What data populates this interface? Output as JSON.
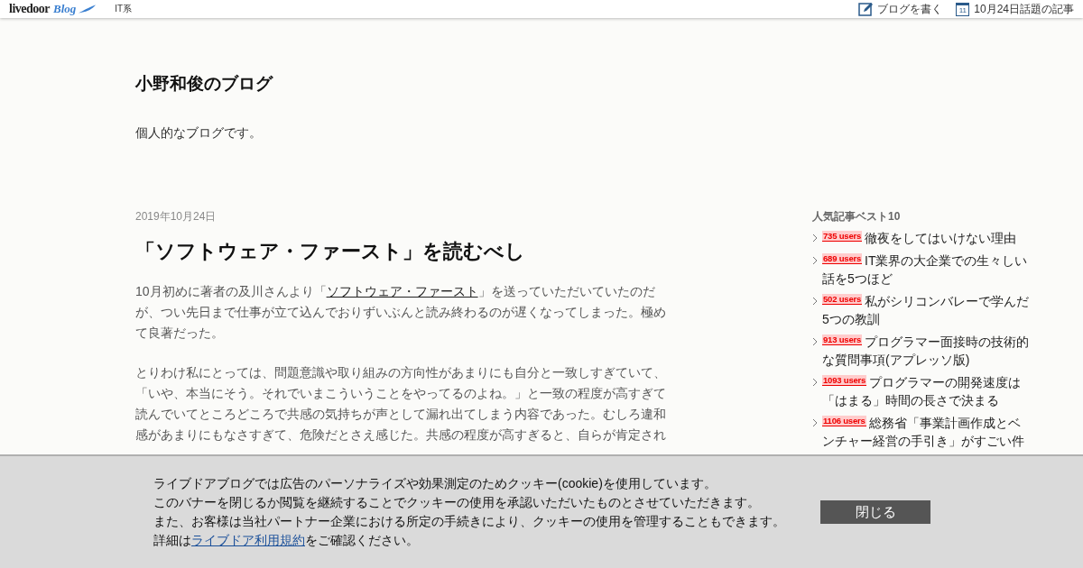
{
  "topbar": {
    "logo": {
      "word": "livedoor",
      "mark": "Blog"
    },
    "category": "IT系",
    "actions": [
      {
        "kind": "write",
        "label": "ブログを書く"
      },
      {
        "kind": "calendar",
        "day": "11",
        "label": "10月24日話題の記事"
      }
    ]
  },
  "blog": {
    "title": "小野和俊のブログ",
    "description": "個人的なブログです。"
  },
  "article": {
    "date": "2019年10月24日",
    "title": "「ソフトウェア・ファースト」を読むべし",
    "paragraphs": [
      {
        "before": "10月初めに著者の及川さんより「",
        "link": "ソフトウェア・ファースト",
        "after": "」を送っていただいていたのだが、つい先日まで仕事が立て込んでおりずいぶんと読み終わるのが遅くなってしまった。極めて良著だった。"
      },
      {
        "before": "とりわけ私にとっては、問題意識や取り組みの方向性があまりにも自分と一致しすぎていて、「いや、本当にそう。それでいまこういうことをやってるのよね。」と一致の程度が高すぎて読んでいてところどころで共感の気持ちが声として漏れ出てしまう内容であった。むしろ違和感があまりにもなさすぎて、危険だとさえ感じた。共感の程度が高すぎると、自らが肯定され"
      }
    ]
  },
  "sidebar": {
    "heading": "人気記事ベスト10",
    "items": [
      {
        "users": "735 users",
        "title": "徹夜をしてはいけない理由"
      },
      {
        "users": "689 users",
        "title": "IT業界の大企業での生々しい話を5つほど"
      },
      {
        "users": "502 users",
        "title": "私がシリコンバレーで学んだ5つの教訓"
      },
      {
        "users": "913 users",
        "title": "プログラマー面接時の技術的な質問事項(アプレッソ版)"
      },
      {
        "users": "1093 users",
        "title": "プログラマーの開発速度は「はまる」時間の長さで決まる"
      },
      {
        "users": "1106 users",
        "title": "総務省「事業計画作成とベンチャー経営の手引き」がすごい件"
      }
    ]
  },
  "cookie_banner": {
    "lines": [
      {
        "before": "ライブドアブログでは広告のパーソナライズや効果測定のためクッキー(cookie)を使用しています。"
      },
      {
        "before": "このバナーを閉じるか閲覧を継続することでクッキーの使用を承認いただいたものとさせていただきます。"
      },
      {
        "before": "また、お客様は当社パートナー企業における所定の手続きにより、クッキーの使用を管理することもできます。"
      },
      {
        "before": "詳細は",
        "link": "ライブドア利用規約",
        "after": "をご確認ください。"
      }
    ],
    "close_button": "閉じる"
  }
}
